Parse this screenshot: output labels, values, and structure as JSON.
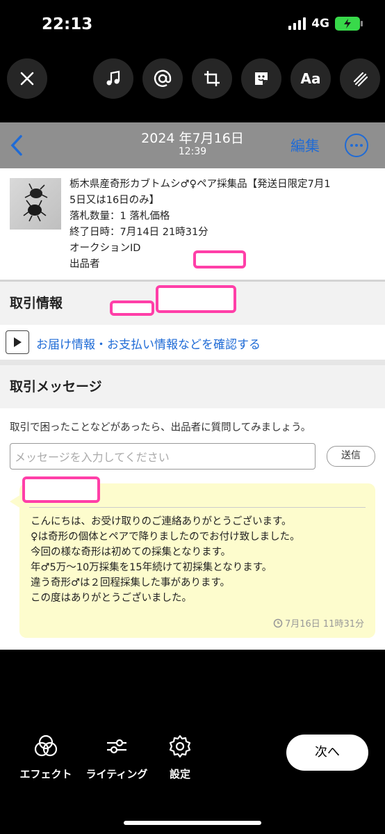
{
  "status": {
    "time": "22:13",
    "network": "4G"
  },
  "toolbar": {
    "tools": [
      "close-icon",
      "music-icon",
      "mention-icon",
      "crop-icon",
      "sticker-icon",
      "text-icon",
      "draw-icon"
    ],
    "text_tool_label": "Aa"
  },
  "screenshot": {
    "nav": {
      "date": "2024 年7月16日",
      "time": "12:39",
      "edit_label": "編集"
    },
    "item": {
      "title_line1": "栃木県産奇形カブトムシ♂♀ペア採集品【発送日限定7月1",
      "title_line2": "5日又は16日のみ】",
      "quantity_label": "落札数量：1 落札価格",
      "end_label": "終了日時：7月14日 21時31分",
      "auction_label": "オークションID",
      "seller_label": "出品者"
    },
    "trade_info": {
      "heading": "取引情報",
      "link": "お届け情報・お支払い情報などを確認する"
    },
    "trade_message": {
      "heading": "取引メッセージ",
      "help": "取引で困ったことなどがあったら、出品者に質問してみましょう。",
      "input_placeholder": "メッセージを入力してください",
      "send_label": "送信",
      "message_lines": [
        "こんにちは、お受け取りのご連絡ありがとうございます。",
        "♀は奇形の個体とペアで降りましたのでお付け致しました。",
        "今回の様な奇形は初めての採集となります。",
        "年♂5万〜10万採集を15年続けて初採集となります。",
        "違う奇形♂は２回程採集した事があります。",
        "この度はありがとうございました。"
      ],
      "message_time": "7月16日 11時31分"
    }
  },
  "bottom": {
    "effect_label": "エフェクト",
    "lighting_label": "ライティング",
    "settings_label": "設定",
    "next_label": "次へ"
  },
  "colors": {
    "accent_blue": "#1f6bd6",
    "redaction_pink": "#ff3fa8",
    "bubble_yellow": "#fdfccd",
    "nav_gray": "#8f8f8f"
  }
}
